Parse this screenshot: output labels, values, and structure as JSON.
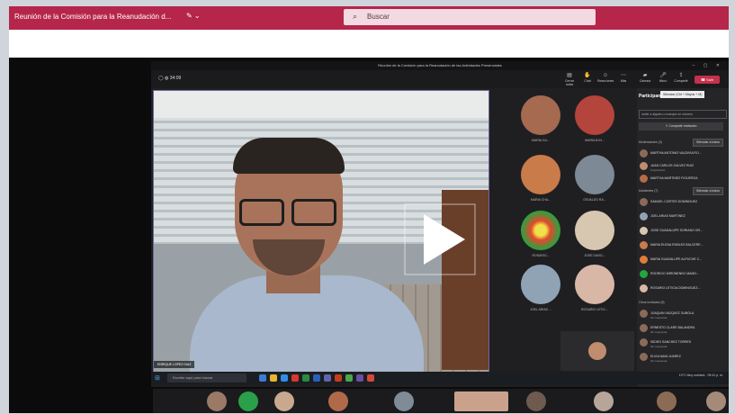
{
  "window": {
    "title": "Reunión de la Comisión para la Reanudación d...",
    "search_placeholder": "Buscar"
  },
  "meeting": {
    "title": "Reunión de la Comisión para la Reanudación de las Actividades Presenciales",
    "timer": "34:09",
    "leave_label": "Salir",
    "toolbar": [
      {
        "label": "Cerrar notes",
        "icon": "chat-icon"
      },
      {
        "label": "Chat",
        "icon": "hand-icon"
      },
      {
        "label": "Reacciones",
        "icon": "smile-icon"
      },
      {
        "label": "Más",
        "icon": "more-icon"
      },
      {
        "label": "Cámara",
        "icon": "camera-icon"
      },
      {
        "label": "Micro",
        "icon": "mic-icon"
      },
      {
        "label": "Compartir",
        "icon": "share-icon"
      }
    ],
    "speaker_name": "ENRIQUE LOPEZ DIAZ"
  },
  "gallery": [
    {
      "name": "MARIA GU...",
      "color": "#a56a4f"
    },
    {
      "name": "MARIA B IN...",
      "color": "#b3453c"
    },
    {
      "name": "MARIA CHA...",
      "color": "#c97b4a"
    },
    {
      "name": "OSVALDO RA...",
      "color": "#7d8a96"
    },
    {
      "name": "ROSARIO...",
      "color": "#22a63f"
    },
    {
      "name": "JOSE DAVID...",
      "color": "#d8c7b0"
    },
    {
      "name": "JOEL ARIAS ...",
      "color": "#8fa3b5"
    },
    {
      "name": "ROSARIO LETIC...",
      "color": "#d9b7a6"
    }
  ],
  "panel": {
    "title": "Participantes",
    "tooltip": "Silenciar (Ctrl + Mayús + M)",
    "invite_placeholder": "Invite a alguien o marque un número",
    "share_label": "Compartir invitación",
    "presenters_label": "Moderadores (3)",
    "mute_all": "Silenciar a todos",
    "attendees_label": "Asistentes (7)",
    "others_label": "Otros invitados (8)",
    "presenters": [
      {
        "name": "MARTHA ANTONIO VALDIVIA RO..."
      },
      {
        "name": "JUAN CARLOS GALVEZ RUIZ",
        "sub": "Organizador"
      },
      {
        "name": "MARTHA MARTINEZ FIGUEROA"
      }
    ],
    "attendees": [
      {
        "name": "SAMUEL CORTES DOMINGUEZ"
      },
      {
        "name": "JOEL ARIAS MARTINEZ"
      },
      {
        "name": "JOSE GUADALUPE SORIANO OR..."
      },
      {
        "name": "MARIA ELENA ROBLES BALCERE..."
      },
      {
        "name": "MARIA GUADALUPE ALPUCHE C..."
      },
      {
        "name": "RODRIGO MIRONENKO MAMO..."
      },
      {
        "name": "ROSARIO LETICIA DOMINGUEZ..."
      }
    ],
    "others": [
      {
        "name": "JOAQUIN VAZQUEZ GUBOLA",
        "sub": "Sin respuesta"
      },
      {
        "name": "ERNESTO CLARE BALANDRA",
        "sub": "Sin respuesta"
      },
      {
        "name": "ISIDRO SANCHEZ TORRES",
        "sub": "Sin respuesta"
      },
      {
        "name": "ELVIA NAVA JUAREZ",
        "sub": "Sin respuesta"
      }
    ]
  },
  "taskbar": {
    "search_placeholder": "Escribe aquí para buscar",
    "status": "19°C Muy nublado",
    "time": "09:41 p. m."
  },
  "strip_colors": [
    "#9a7a66",
    "#2aa04a",
    "#c9a890",
    "#b06a4a",
    "#7f8b96",
    "#caa28c",
    "#6e5a4e",
    "#b7a59a",
    "#8c6b55",
    "#a58a7a"
  ]
}
